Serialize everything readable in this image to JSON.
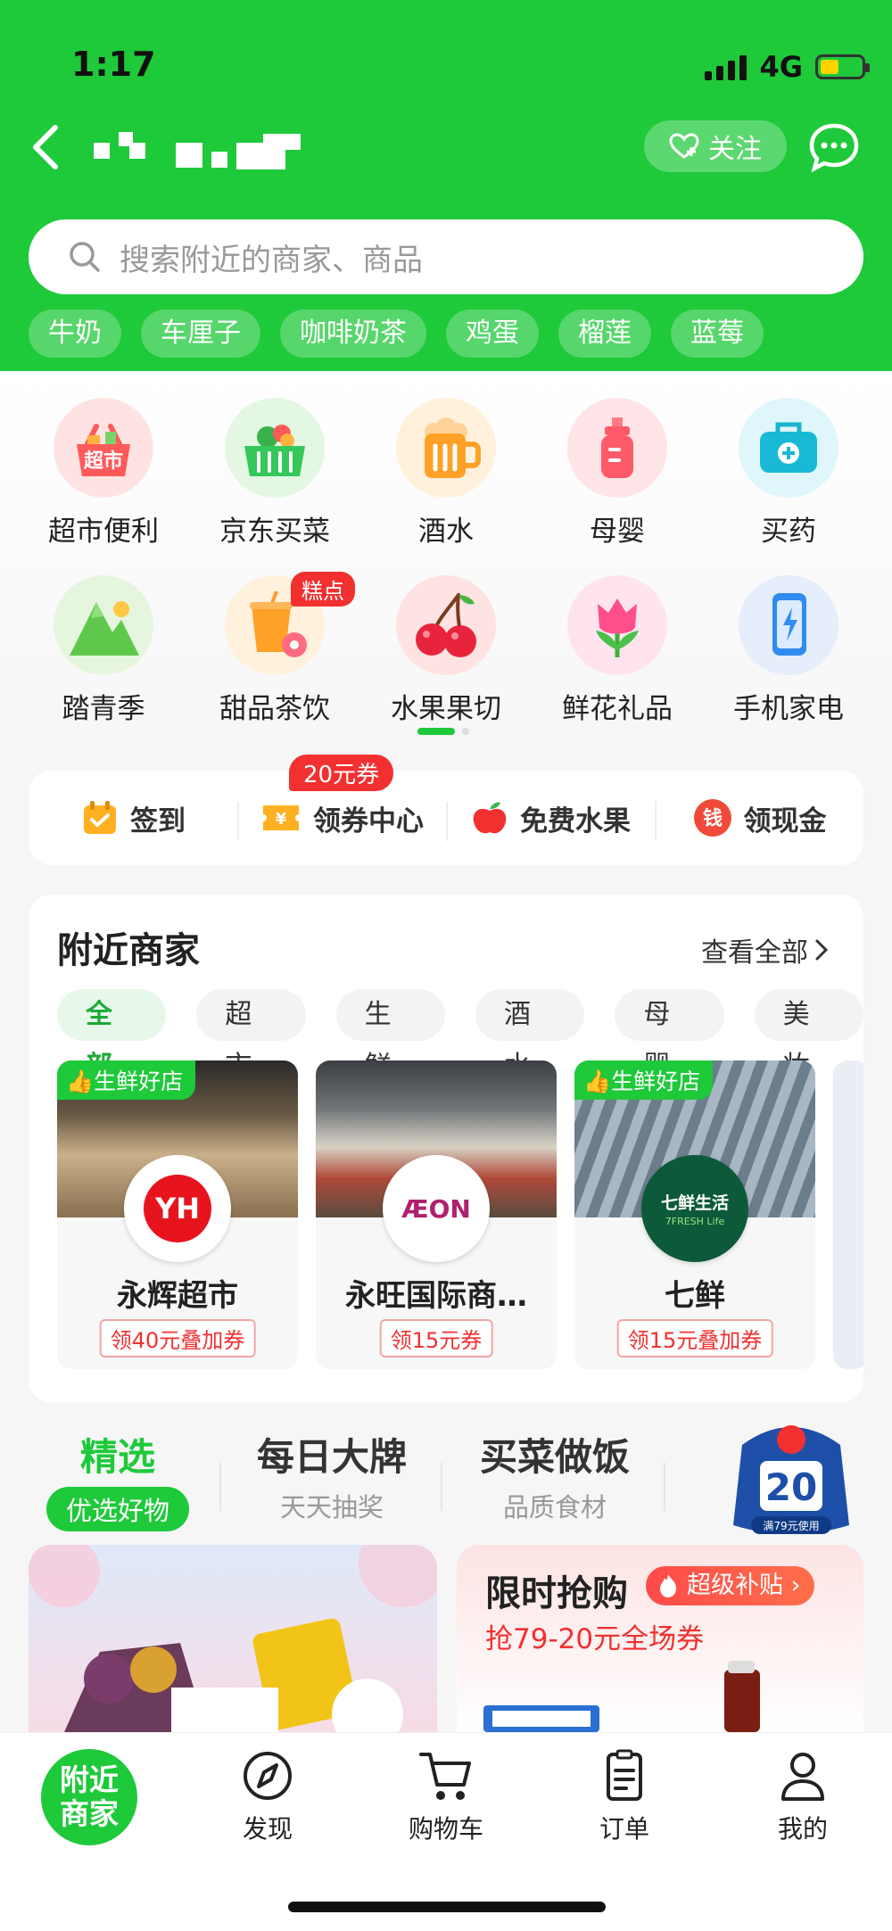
{
  "status_bar": {
    "time": "1:17",
    "network": "4G",
    "battery_level": 0.45
  },
  "header": {
    "follow_label": "关注",
    "search_placeholder": "搜索附近的商家、商品",
    "hot_tags": [
      "牛奶",
      "车厘子",
      "咖啡奶茶",
      "鸡蛋",
      "榴莲",
      "蓝莓"
    ]
  },
  "categories": [
    {
      "label": "超市便利",
      "icon": "supermarket-basket-icon",
      "icon_text": "超市"
    },
    {
      "label": "京东买菜",
      "icon": "vegetable-basket-icon"
    },
    {
      "label": "酒水",
      "icon": "beer-mug-icon"
    },
    {
      "label": "母婴",
      "icon": "baby-bottle-icon"
    },
    {
      "label": "买药",
      "icon": "medicine-kit-icon"
    },
    {
      "label": "踏青季",
      "icon": "mountain-icon"
    },
    {
      "label": "甜品茶饮",
      "icon": "milk-tea-icon",
      "badge": "糕点"
    },
    {
      "label": "水果果切",
      "icon": "cherry-icon"
    },
    {
      "label": "鲜花礼品",
      "icon": "tulip-icon"
    },
    {
      "label": "手机家电",
      "icon": "phone-charging-icon"
    }
  ],
  "quick_actions": {
    "coupon_tip": "20元券",
    "items": [
      {
        "label": "签到",
        "icon": "calendar-check-icon"
      },
      {
        "label": "领券中心",
        "icon": "coupon-icon"
      },
      {
        "label": "免费水果",
        "icon": "apple-icon"
      },
      {
        "label": "领现金",
        "icon": "cash-icon",
        "icon_text": "钱"
      }
    ]
  },
  "nearby": {
    "title": "附近商家",
    "see_all": "查看全部",
    "filters": [
      "全部",
      "超市",
      "生鲜",
      "酒水",
      "母婴",
      "美妆"
    ],
    "stores": [
      {
        "name": "永辉超市",
        "tag": "生鲜好店",
        "coupon": "领40元叠加券",
        "logo_text": "YH"
      },
      {
        "name": "永旺国际商…",
        "tag": "",
        "coupon": "领15元券",
        "logo_text": "ÆON"
      },
      {
        "name": "七鲜",
        "tag": "生鲜好店",
        "coupon": "领15元叠加券",
        "logo_text": "七鲜生活"
      }
    ]
  },
  "feed_tabs": [
    {
      "title": "精选",
      "subtitle": "优选好物"
    },
    {
      "title": "每日大牌",
      "subtitle": "天天抽奖"
    },
    {
      "title": "买菜做饭",
      "subtitle": "品质食材"
    }
  ],
  "promo_badge": {
    "amount": "20",
    "note": "满79元使用"
  },
  "flash_sale": {
    "title": "限时抢购",
    "tag": "超级补贴",
    "subtitle": "抢79-20元全场券"
  },
  "tabbar": {
    "home_label": "附近商家",
    "items": [
      {
        "label": "发现",
        "icon": "compass-icon"
      },
      {
        "label": "购物车",
        "icon": "cart-icon"
      },
      {
        "label": "订单",
        "icon": "order-list-icon"
      },
      {
        "label": "我的",
        "icon": "user-icon"
      }
    ]
  },
  "colors": {
    "brand_green": "#1ec93a",
    "accent_red": "#f23030"
  }
}
